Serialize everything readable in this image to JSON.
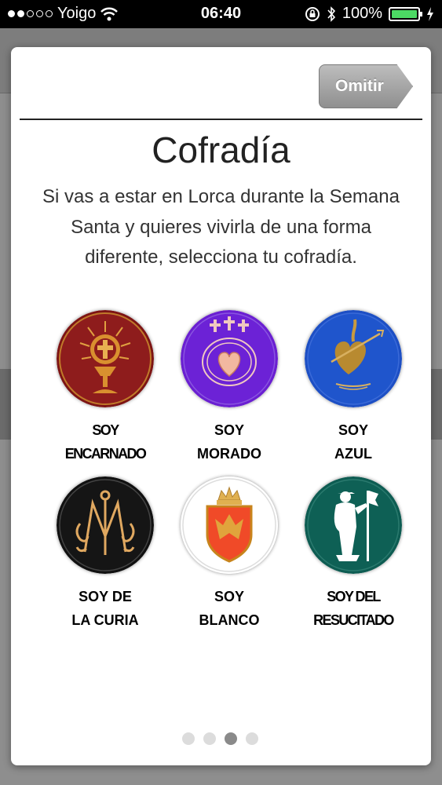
{
  "status_bar": {
    "carrier": "Yoigo",
    "time": "06:40",
    "battery": "100%",
    "battery_level": 1.0
  },
  "modal": {
    "omit_label": "Omitir",
    "title": "Cofradía",
    "description": "Si vas a estar en Lorca durante la Semana Santa y quieres vivirla de una forma diferente, selecciona tu cofradía.",
    "cofradias": [
      {
        "line1": "SOY",
        "line2": "ENCARNADO",
        "icon": "monstrance-icon",
        "color": "#8b1a1a"
      },
      {
        "line1": "SOY",
        "line2": "MORADO",
        "icon": "crown-of-thorns-heart-icon",
        "color": "#6a1fd1"
      },
      {
        "line1": "SOY",
        "line2": "AZUL",
        "icon": "pierced-heart-icon",
        "color": "#1d4fc4"
      },
      {
        "line1": "SOY DE",
        "line2": "LA CURIA",
        "icon": "marian-monogram-icon",
        "color": "#111111"
      },
      {
        "line1": "SOY",
        "line2": "BLANCO",
        "icon": "crowned-shield-icon",
        "color": "#ffffff"
      },
      {
        "line1": "SOY DEL",
        "line2": "RESUCITADO",
        "icon": "risen-christ-icon",
        "color": "#0d5c52"
      }
    ],
    "pager": {
      "count": 4,
      "active": 3
    }
  }
}
